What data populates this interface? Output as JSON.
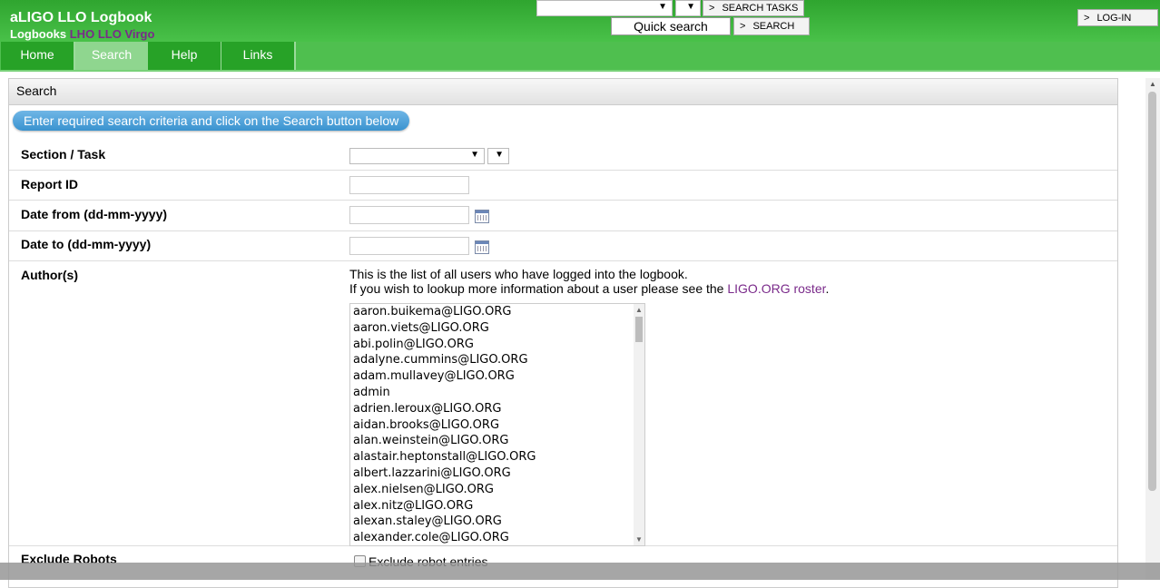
{
  "header": {
    "app_title": "aLIGO LLO Logbook",
    "logbooks_label": "Logbooks",
    "logbook_links": [
      "LHO",
      "LLO",
      "Virgo"
    ],
    "search_tasks_label": "SEARCH TASKS",
    "quick_search_value": "Quick search",
    "search_label": "SEARCH",
    "login_label": "LOG-IN"
  },
  "nav": {
    "items": [
      "Home",
      "Search",
      "Help",
      "Links"
    ],
    "active": "Search"
  },
  "panel": {
    "title": "Search",
    "instruction": "Enter required search criteria and click on the Search button below"
  },
  "form": {
    "section_task_label": "Section / Task",
    "report_id_label": "Report ID",
    "date_from_label": "Date from (dd-mm-yyyy)",
    "date_to_label": "Date to (dd-mm-yyyy)",
    "authors_label": "Author(s)",
    "authors_note_1": "This is the list of all users who have logged into the logbook.",
    "authors_note_2_prefix": "If you wish to lookup more information about a user please see the ",
    "authors_note_link": "LIGO.ORG roster",
    "authors_note_2_suffix": ".",
    "exclude_robots_label": "Exclude Robots",
    "exclude_robots_option": "Exclude robot entries"
  },
  "authors": [
    "aaron.buikema@LIGO.ORG",
    "aaron.viets@LIGO.ORG",
    "abi.polin@LIGO.ORG",
    "adalyne.cummins@LIGO.ORG",
    "adam.mullavey@LIGO.ORG",
    "admin",
    "adrien.leroux@LIGO.ORG",
    "aidan.brooks@LIGO.ORG",
    "alan.weinstein@LIGO.ORG",
    "alastair.heptonstall@LIGO.ORG",
    "albert.lazzarini@LIGO.ORG",
    "alex.nielsen@LIGO.ORG",
    "alex.nitz@LIGO.ORG",
    "alexan.staley@LIGO.ORG",
    "alexander.cole@LIGO.ORG"
  ],
  "colors": {
    "header_green": "#2fa52f",
    "nav_green": "#27a227",
    "link_purple": "#7a2a8a",
    "pill_blue": "#3a93cf"
  }
}
